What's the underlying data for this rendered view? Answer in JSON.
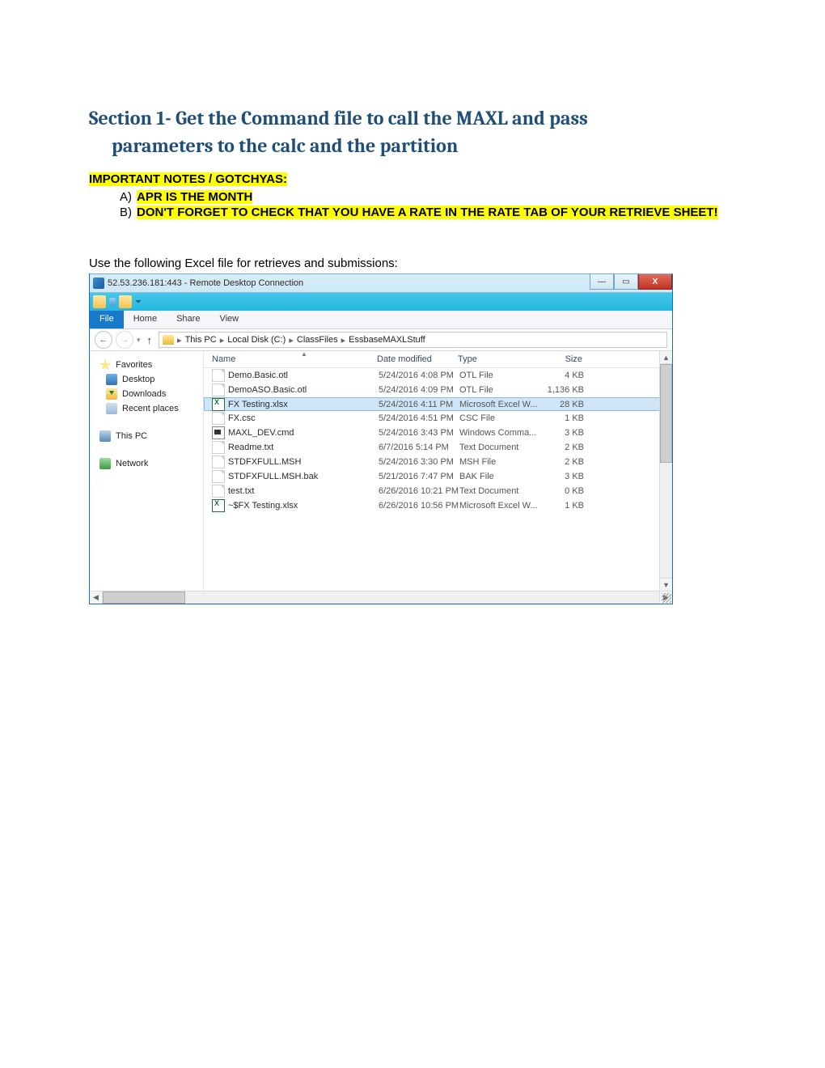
{
  "section": {
    "title_line1": "Section 1- Get the Command file to call the MAXL and pass",
    "title_line2": "parameters to the calc and the partition"
  },
  "important": {
    "label": "IMPORTANT NOTES / GOTCHYAS:",
    "items": [
      {
        "marker": "A)",
        "text": "APR IS THE MONTH"
      },
      {
        "marker": "B)",
        "text": "DON'T FORGET TO CHECK THAT YOU HAVE A RATE IN THE RATE TAB OF YOUR RETRIEVE SHEET!"
      }
    ]
  },
  "instruction": "Use the following Excel file for retrieves and submissions:",
  "rdc": {
    "title": "52.53.236.181:443 - Remote Desktop Connection",
    "min": "—",
    "max": "▭",
    "close": "X"
  },
  "explorer": {
    "tabs": {
      "file": "File",
      "home": "Home",
      "share": "Share",
      "view": "View"
    },
    "breadcrumb": [
      "This PC",
      "Local Disk (C:)",
      "ClassFiles",
      "EssbaseMAXLStuff"
    ],
    "nav": {
      "favorites": "Favorites",
      "desktop": "Desktop",
      "downloads": "Downloads",
      "recent": "Recent places",
      "thispc": "This PC",
      "network": "Network"
    },
    "cols": {
      "name": "Name",
      "date": "Date modified",
      "type": "Type",
      "size": "Size"
    },
    "files": [
      {
        "icon": "generic",
        "name": "Demo.Basic.otl",
        "date": "5/24/2016 4:08 PM",
        "type": "OTL File",
        "size": "4 KB",
        "sel": false
      },
      {
        "icon": "generic",
        "name": "DemoASO.Basic.otl",
        "date": "5/24/2016 4:09 PM",
        "type": "OTL File",
        "size": "1,136 KB",
        "sel": false
      },
      {
        "icon": "xl",
        "name": "FX Testing.xlsx",
        "date": "5/24/2016 4:11 PM",
        "type": "Microsoft Excel W...",
        "size": "28 KB",
        "sel": true
      },
      {
        "icon": "generic",
        "name": "FX.csc",
        "date": "5/24/2016 4:51 PM",
        "type": "CSC File",
        "size": "1 KB",
        "sel": false
      },
      {
        "icon": "cmd",
        "name": "MAXL_DEV.cmd",
        "date": "5/24/2016 3:43 PM",
        "type": "Windows Comma...",
        "size": "3 KB",
        "sel": false
      },
      {
        "icon": "generic",
        "name": "Readme.txt",
        "date": "6/7/2016 5:14 PM",
        "type": "Text Document",
        "size": "2 KB",
        "sel": false
      },
      {
        "icon": "generic",
        "name": "STDFXFULL.MSH",
        "date": "5/24/2016 3:30 PM",
        "type": "MSH File",
        "size": "2 KB",
        "sel": false
      },
      {
        "icon": "generic",
        "name": "STDFXFULL.MSH.bak",
        "date": "5/21/2016 7:47 PM",
        "type": "BAK File",
        "size": "3 KB",
        "sel": false
      },
      {
        "icon": "generic",
        "name": "test.txt",
        "date": "6/26/2016 10:21 PM",
        "type": "Text Document",
        "size": "0 KB",
        "sel": false
      },
      {
        "icon": "xl",
        "name": "~$FX Testing.xlsx",
        "date": "6/26/2016 10:56 PM",
        "type": "Microsoft Excel W...",
        "size": "1 KB",
        "sel": false
      }
    ]
  }
}
